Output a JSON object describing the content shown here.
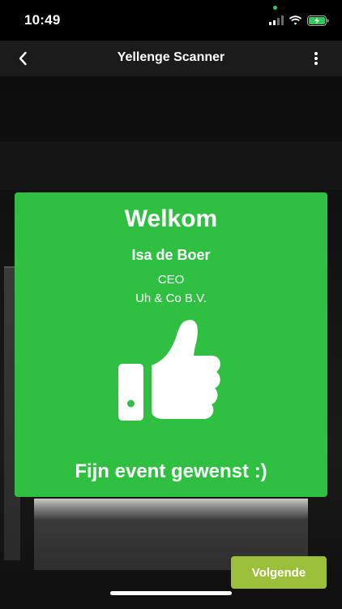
{
  "status_bar": {
    "time": "10:49",
    "icons": [
      "cellular-signal-icon",
      "wifi-icon",
      "battery-charging-icon"
    ]
  },
  "nav": {
    "title": "Yellenge Scanner",
    "icons": [
      "chevron-left-icon",
      "more-vertical-icon"
    ]
  },
  "welcome_card": {
    "heading": "Welkom",
    "name": "Isa de Boer",
    "role": "CEO",
    "company": "Uh & Co B.V.",
    "icon": "thumbs-up-icon",
    "message": "Fijn event gewenst :)",
    "background_color": "#2fc042"
  },
  "next_button": {
    "label": "Volgende",
    "color": "#9cbf3a"
  }
}
